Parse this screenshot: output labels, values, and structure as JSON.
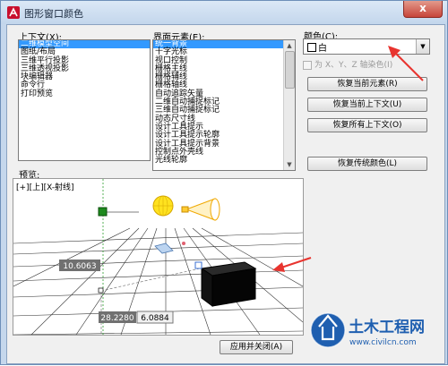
{
  "window": {
    "title": "图形窗口颜色",
    "close": "x"
  },
  "context": {
    "label": "上下文(X):",
    "items": [
      "二维模型空间",
      "图纸/布局",
      "三维平行投影",
      "三维透视投影",
      "块编辑器",
      "命令行",
      "打印预览"
    ],
    "selected": 0
  },
  "interface": {
    "label": "界面元素(E):",
    "items": [
      "统一背景",
      "十字光标",
      "视口控制",
      "栅格主线",
      "栅格辅线",
      "栅格轴线",
      "自动追踪矢量",
      "二维自动捕捉标记",
      "三维自动捕捉标记",
      "动态尺寸线",
      "设计工具提示",
      "设计工具提示轮廓",
      "设计工具提示背景",
      "控制点外壳线",
      "光线轮廓"
    ],
    "selected": 0
  },
  "color": {
    "label": "颜色(C):",
    "value": "白",
    "swatch": "#ffffff",
    "tint_label": "为 X、Y、Z 轴染色(I)"
  },
  "buttons": {
    "restore_element": "恢复当前元素(R)",
    "restore_context": "恢复当前上下文(U)",
    "restore_all": "恢复所有上下文(O)",
    "restore_classic": "恢复传统颜色(L)",
    "apply_close": "应用并关闭(A)"
  },
  "preview": {
    "label": "预览:",
    "viewport": "[+][上][X-射线]",
    "dim1": "10.6063",
    "dim2": "28.2280",
    "dim3": "6.0884"
  },
  "watermark": {
    "brand": "土木工程网",
    "url": "www.civilcn.com"
  }
}
